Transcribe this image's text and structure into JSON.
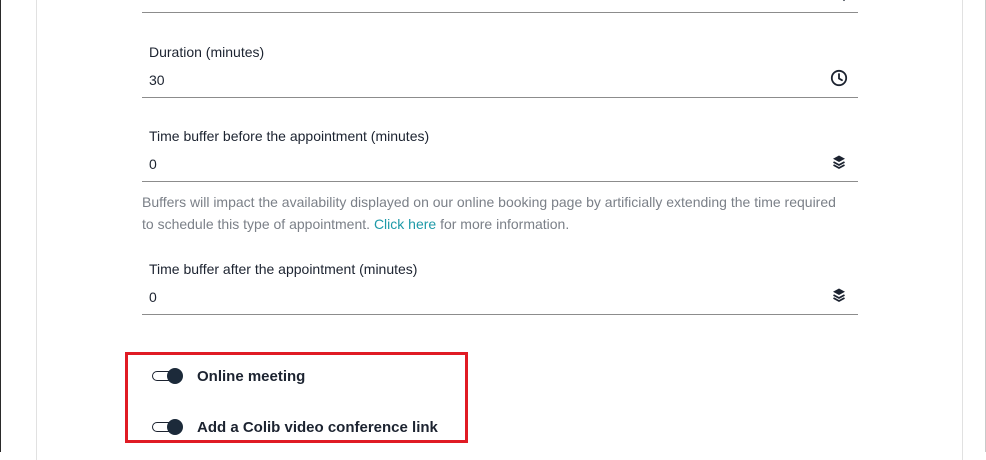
{
  "form": {
    "fields": [
      {
        "label": "Duration (minutes)",
        "value": "30",
        "icon": "clock-icon"
      },
      {
        "label": "Time buffer before the appointment (minutes)",
        "value": "0",
        "icon": "layers-icon"
      },
      {
        "label": "Time buffer after the appointment (minutes)",
        "value": "0",
        "icon": "layers-icon"
      }
    ],
    "help": {
      "text_before": "Buffers will impact the availability displayed on our online booking page by artificially extending the time required to schedule this type of appointment. ",
      "link": "Click here",
      "text_after": " for more information."
    },
    "toggles": [
      {
        "label": "Online meeting",
        "on": true
      },
      {
        "label": "Add a Colib video conference link",
        "on": true
      }
    ]
  },
  "colors": {
    "text": "#1c2330",
    "muted": "#7b8088",
    "link": "#1e9aa8",
    "highlight": "#e01b24",
    "toggle": "#1c2a3a"
  }
}
